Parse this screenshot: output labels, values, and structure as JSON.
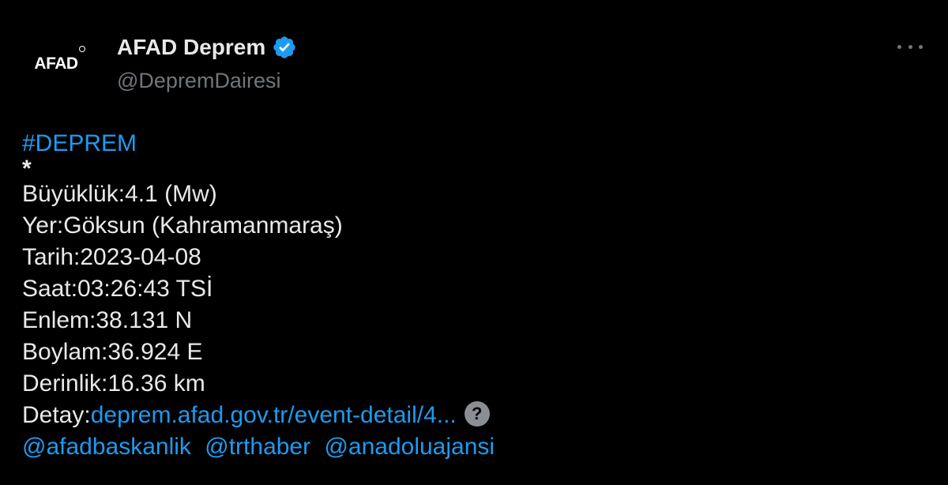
{
  "author": {
    "avatar_text": "AFAD",
    "display_name": "AFAD Deprem",
    "handle": "@DepremDairesi",
    "verified_icon": "verified-badge-icon",
    "verified_color": "#1d9bf0"
  },
  "menu": {
    "icon": "more-options-icon"
  },
  "tweet": {
    "hashtag": "#DEPREM",
    "separator": "*",
    "magnitude": "Büyüklük:4.1 (Mw)",
    "location": "Yer:Göksun (Kahramanmaraş)",
    "date": "Tarih:2023-04-08",
    "time": "Saat:03:26:43 TSİ",
    "latitude": "Enlem:38.131 N",
    "longitude": "Boylam:36.924 E",
    "depth": "Derinlik:16.36 km",
    "detail_label": "Detay:",
    "detail_link": "deprem.afad.gov.tr/event-detail/4...",
    "help_icon": "help-circle-icon",
    "help_glyph": "?",
    "mentions": [
      "@afadbaskanlik",
      "@trthaber",
      "@anadoluajansi"
    ]
  },
  "colors": {
    "background": "#000000",
    "text": "#e7e9ea",
    "secondary_text": "#71767b",
    "link": "#1d9bf0"
  }
}
